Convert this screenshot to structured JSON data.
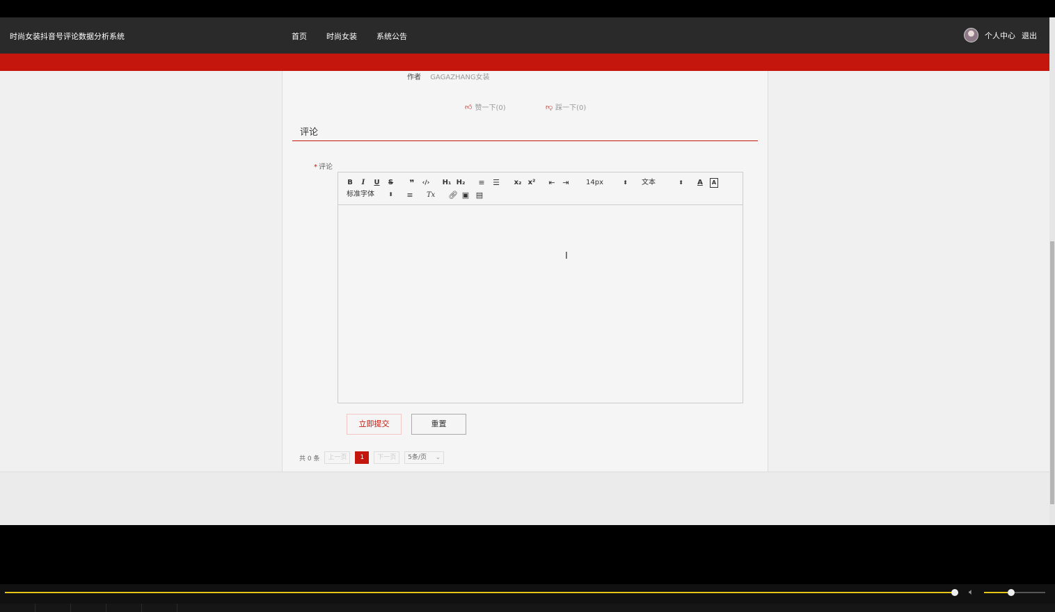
{
  "header": {
    "title": "时尚女装抖音号评论数据分析系统",
    "nav": [
      "首页",
      "时尚女装",
      "系统公告"
    ],
    "profile_label": "个人中心",
    "logout_label": "退出"
  },
  "article": {
    "author_label": "作者",
    "author_value": "GAGAZHANG女装"
  },
  "votes": {
    "up_label": "赞一下(0)",
    "down_label": "踩一下(0)"
  },
  "comments": {
    "section_title": "评论",
    "field_label": "评论",
    "required_mark": "*"
  },
  "editor": {
    "font_size_value": "14px",
    "text_style_value": "文本",
    "font_family_value": "标准字体",
    "cursor_glyph": "I"
  },
  "actions": {
    "submit_label": "立即提交",
    "reset_label": "重置"
  },
  "pager": {
    "total": "共 0 条",
    "prev_label": "上一页",
    "current_page": "1",
    "next_label": "下一页",
    "page_size": "5条/页"
  },
  "colors": {
    "accent": "#c4160c",
    "topbar": "#2a2a2a",
    "seek_bar": "#e6c619"
  },
  "player": {
    "seek_progress": 0.906,
    "volume_level": 0.44
  }
}
